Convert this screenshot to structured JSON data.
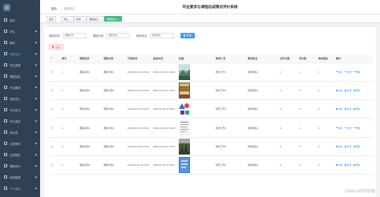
{
  "app": {
    "title": "毕业要求与课程达成情况评价系统"
  },
  "header": {
    "breadcrumb": [
      "首页",
      "课程信息"
    ],
    "links": [
      "",
      ""
    ]
  },
  "sidebar": {
    "items": [
      {
        "label": "首页"
      },
      {
        "label": "学生"
      },
      {
        "label": "教师"
      },
      {
        "label": "课程信息"
      },
      {
        "label": "学生选课"
      },
      {
        "label": "课程目标"
      },
      {
        "label": "毕业要求"
      },
      {
        "label": "成绩录入"
      },
      {
        "label": "毕业作业"
      },
      {
        "label": "毕业成绩"
      },
      {
        "label": "评价表"
      },
      {
        "label": "达成情况"
      },
      {
        "label": "达成报告"
      },
      {
        "label": "课程评价"
      },
      {
        "label": "系统管理"
      },
      {
        "label": "个人中心"
      }
    ]
  },
  "tags": [
    {
      "label": "首页"
    },
    {
      "label": "学生"
    },
    {
      "label": "教师"
    },
    {
      "label": "课程信息"
    },
    {
      "label": "课程信息"
    }
  ],
  "search": {
    "fields": [
      {
        "label": "课程名称",
        "placeholder": "课程名称"
      },
      {
        "label": "课程分类",
        "placeholder": "课程分类"
      },
      {
        "label": "教师姓名",
        "placeholder": "教师姓名"
      }
    ],
    "button": "查询"
  },
  "toolbar": {
    "delete": "删除"
  },
  "table": {
    "columns": [
      "",
      "索引",
      "课程名称",
      "课程分类",
      "开课时间",
      "结束时间",
      "封面",
      "教师工号",
      "教师姓名",
      "总学分数",
      "评价数",
      "审核通过",
      "操作"
    ],
    "rows": [
      {
        "index": "1",
        "name": "课程名称1",
        "category": "课程分类1",
        "start": "2024-01-16 22:13:02",
        "end": "2024-01-16 22:13:02",
        "cover": "mountain",
        "teacher_no": "教师工号1",
        "teacher_name": "教师姓名1",
        "credits": "1",
        "reviews": "1",
        "approved": "1"
      },
      {
        "index": "2",
        "name": "课程名称2",
        "category": "课程分类2",
        "start": "2024-01-16 22:13:02",
        "end": "2024-01-16 22:13:02",
        "cover": "books",
        "teacher_no": "教师工号2",
        "teacher_name": "教师姓名2",
        "credits": "2",
        "reviews": "2",
        "approved": "2"
      },
      {
        "index": "3",
        "name": "课程名称3",
        "category": "课程分类3",
        "start": "2024-01-16 22:13:02",
        "end": "2024-01-16 22:13:02",
        "cover": "shapes",
        "teacher_no": "教师工号3",
        "teacher_name": "教师姓名3",
        "credits": "3",
        "reviews": "3",
        "approved": "3"
      },
      {
        "index": "4",
        "name": "课程名称4",
        "category": "课程分类4",
        "start": "2024-01-16 22:13:02",
        "end": "2024-01-16 22:13:02",
        "cover": "document",
        "teacher_no": "教师工号4",
        "teacher_name": "教师姓名4",
        "credits": "4",
        "reviews": "4",
        "approved": "4"
      },
      {
        "index": "5",
        "name": "课程名称5",
        "category": "课程分类5",
        "start": "2024-01-16 22:13:02",
        "end": "2024-01-16 22:13:02",
        "cover": "forest",
        "teacher_no": "教师工号5",
        "teacher_name": "教师姓名5",
        "credits": "5",
        "reviews": "5",
        "approved": "5"
      },
      {
        "index": "6",
        "name": "课程名称6",
        "category": "课程分类6",
        "start": "2024-01-16 22:13:02",
        "end": "2024-01-16 22:13:02",
        "cover": "blue",
        "teacher_no": "教师工号6",
        "teacher_name": "教师姓名6",
        "credits": "6",
        "reviews": "6",
        "approved": "6"
      }
    ],
    "actions": {
      "edit": "详情",
      "modify": "修改",
      "delete": "删除"
    }
  },
  "watermark": "CSDN @平哥学姐",
  "colors": {
    "sidebar": "#304156",
    "primary": "#409eff",
    "tag_active": "#42b983",
    "danger": "#f56c6c"
  }
}
